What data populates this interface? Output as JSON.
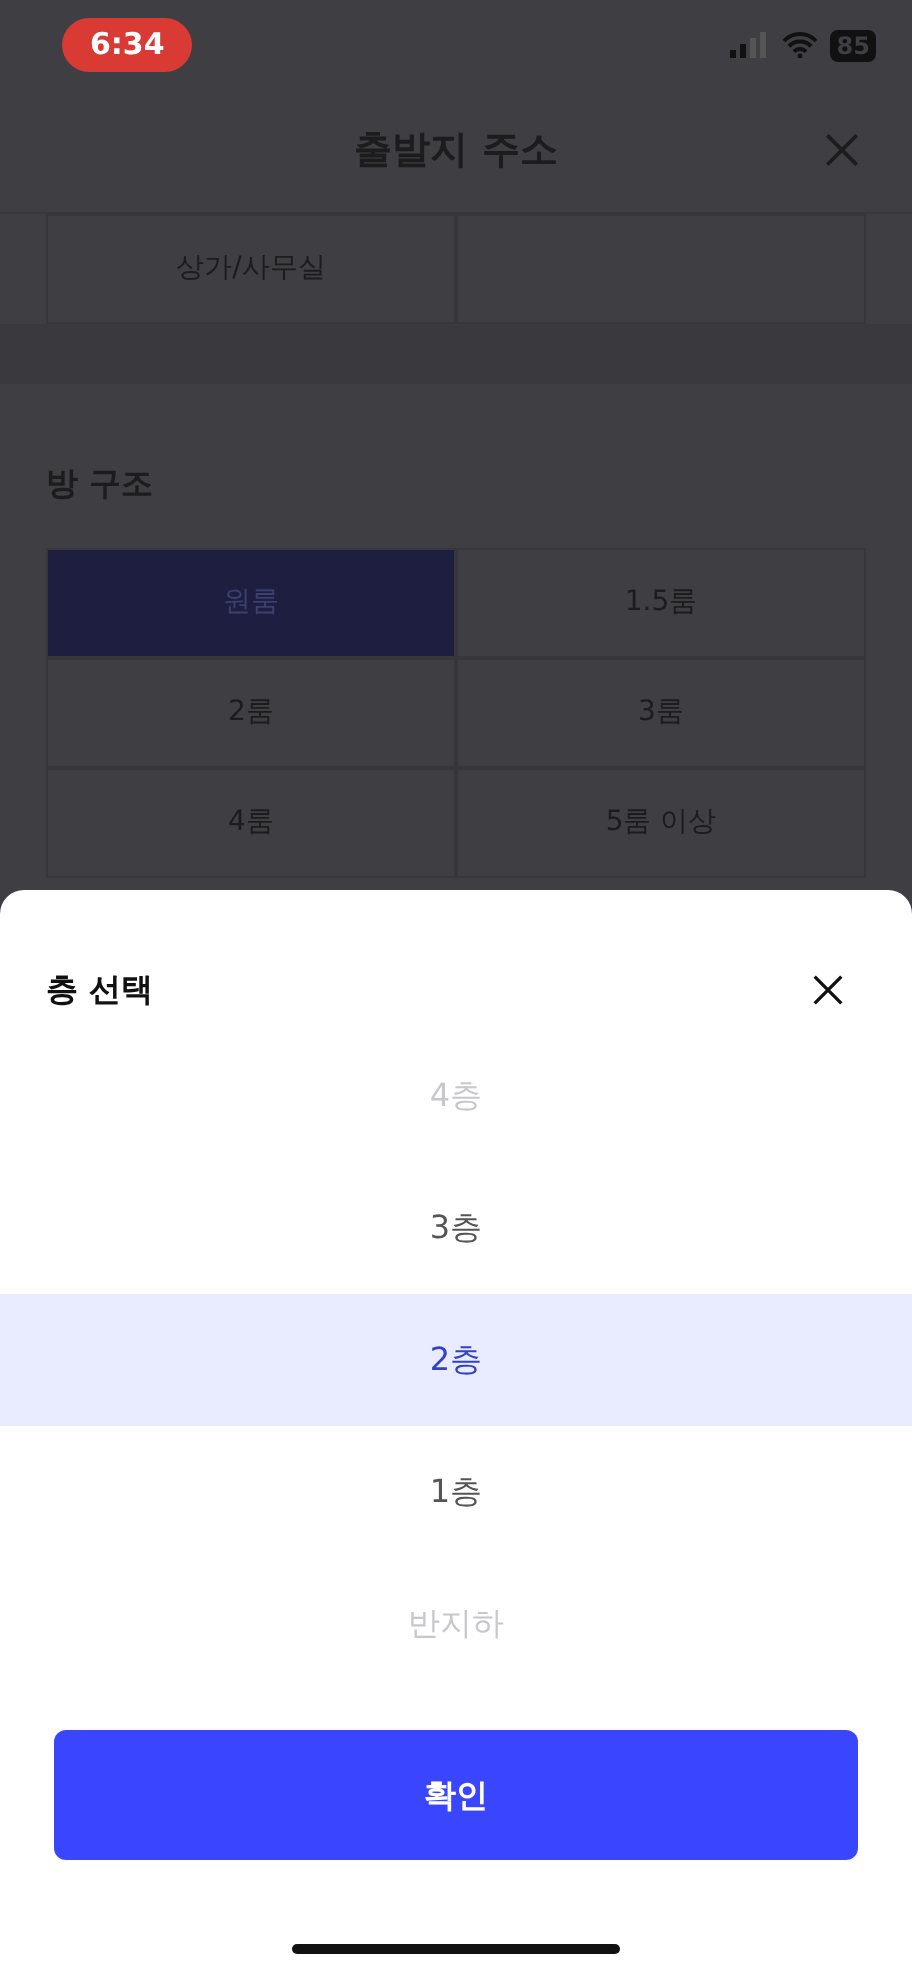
{
  "status_bar": {
    "time": "6:34",
    "battery": "85"
  },
  "header": {
    "title": "출발지 주소"
  },
  "building_type": {
    "options": [
      {
        "label": "상가/사무실",
        "selected": false
      },
      {
        "selected": false
      }
    ]
  },
  "room_structure": {
    "title": "방 구조",
    "options": [
      {
        "label": "원룸",
        "selected": true
      },
      {
        "label": "1.5룸",
        "selected": false
      },
      {
        "label": "2룸",
        "selected": false
      },
      {
        "label": "3룸",
        "selected": false
      },
      {
        "label": "4룸",
        "selected": false
      },
      {
        "label": "5룸 이상",
        "selected": false
      }
    ]
  },
  "floor_sheet": {
    "title": "층 선택",
    "items": [
      {
        "label": "4층",
        "selected": false
      },
      {
        "label": "3층",
        "selected": false
      },
      {
        "label": "2층",
        "selected": true
      },
      {
        "label": "1층",
        "selected": false
      },
      {
        "label": "반지하",
        "selected": false
      }
    ],
    "confirm": "확인"
  }
}
